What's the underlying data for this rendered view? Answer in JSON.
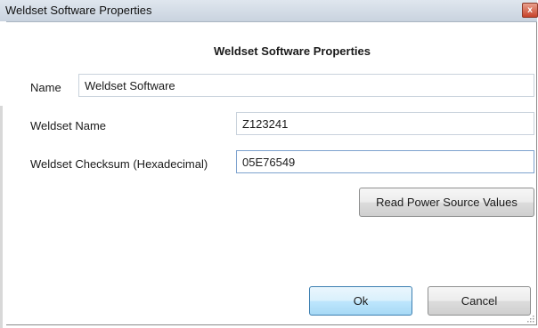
{
  "window": {
    "title": "Weldset Software Properties",
    "close_symbol": "x"
  },
  "dialog": {
    "heading": "Weldset Software Properties"
  },
  "form": {
    "name_label": "Name",
    "name_value": "Weldset Software",
    "weldset_name_label": "Weldset Name",
    "weldset_name_value": "Z123241",
    "checksum_label": "Weldset Checksum (Hexadecimal)",
    "checksum_value": "05E76549"
  },
  "buttons": {
    "read_power_source": "Read Power Source Values",
    "ok": "Ok",
    "cancel": "Cancel"
  },
  "icons": {
    "close": "close-icon",
    "resize_grip": "resize-grip-icon"
  },
  "colors": {
    "default_button_border": "#3c7fb1",
    "close_button": "#c7432a"
  }
}
